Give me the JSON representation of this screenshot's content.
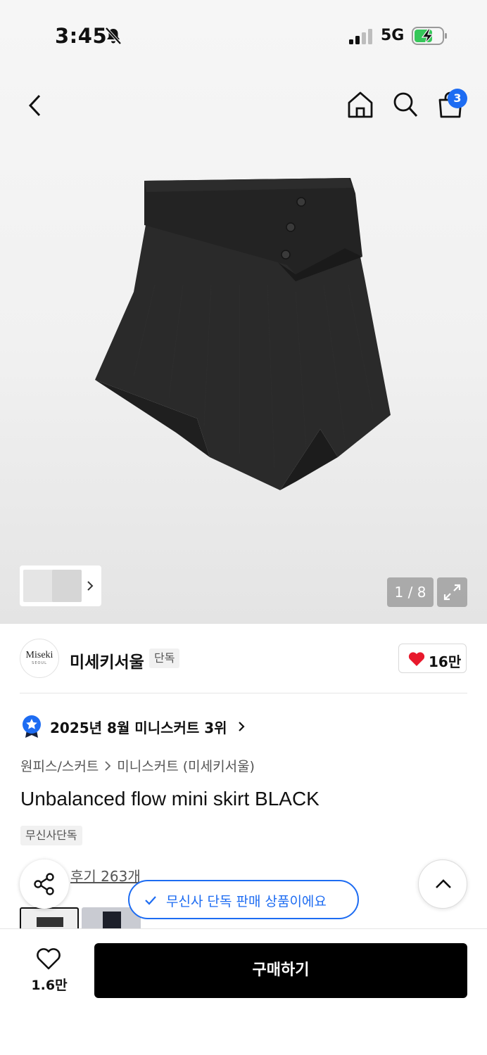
{
  "status_bar": {
    "time": "3:45",
    "network": "5G"
  },
  "nav": {
    "cart_count": "3"
  },
  "gallery": {
    "page_counter": "1 / 8"
  },
  "brand": {
    "logo_text": "Miseki",
    "logo_sub": "SEOUL",
    "name": "미세키서울",
    "tag": "단독",
    "likes": "16만"
  },
  "ranking": {
    "text": "2025년 8월 미니스커트 3위"
  },
  "breadcrumb": {
    "level1": "원피스/스커트",
    "level2": "미니스커트 (미세키서울)"
  },
  "product": {
    "title": "Unbalanced flow mini skirt BLACK",
    "exclusive_tag": "무신사단독"
  },
  "review": {
    "text": "후기 263개"
  },
  "toast": {
    "text": "무신사 단독 판매 상품이에요"
  },
  "bottom_bar": {
    "wish_count": "1.6만",
    "buy_label": "구매하기"
  },
  "colors": {
    "accent_blue": "#1d6cf2",
    "heart_red": "#e8192c",
    "buy_button": "#000000"
  },
  "icons": [
    "bell-off-icon",
    "signal-icon",
    "battery-charging-icon",
    "back-chevron-icon",
    "home-icon",
    "search-icon",
    "cart-icon",
    "expand-icon",
    "heart-icon",
    "medal-star-icon",
    "share-icon",
    "chevron-up-icon",
    "check-icon"
  ]
}
